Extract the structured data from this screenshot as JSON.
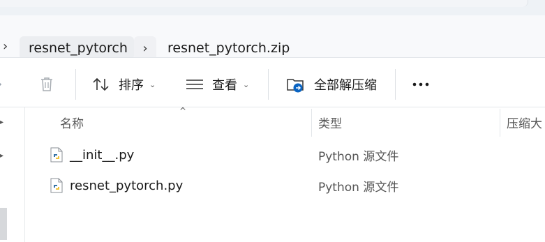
{
  "breadcrumb": {
    "items": [
      {
        "label": "resnet_pytorch"
      },
      {
        "label": "resnet_pytorch.zip"
      }
    ]
  },
  "toolbar": {
    "sort_label": "排序",
    "view_label": "查看",
    "extract_all_label": "全部解压缩",
    "more_icon": "more-horizontal-icon",
    "delete_icon": "trash-icon"
  },
  "columns": {
    "name": "名称",
    "type": "类型",
    "compressed_size": "压缩大"
  },
  "files": [
    {
      "name": "__init__.py",
      "type": "Python 源文件",
      "icon": "python-file-icon"
    },
    {
      "name": "resnet_pytorch.py",
      "type": "Python 源文件",
      "icon": "python-file-icon"
    }
  ],
  "colors": {
    "accent": "#0a64c2",
    "address_bg": "#f8f9fb",
    "crumb_bg": "#eceef1"
  }
}
